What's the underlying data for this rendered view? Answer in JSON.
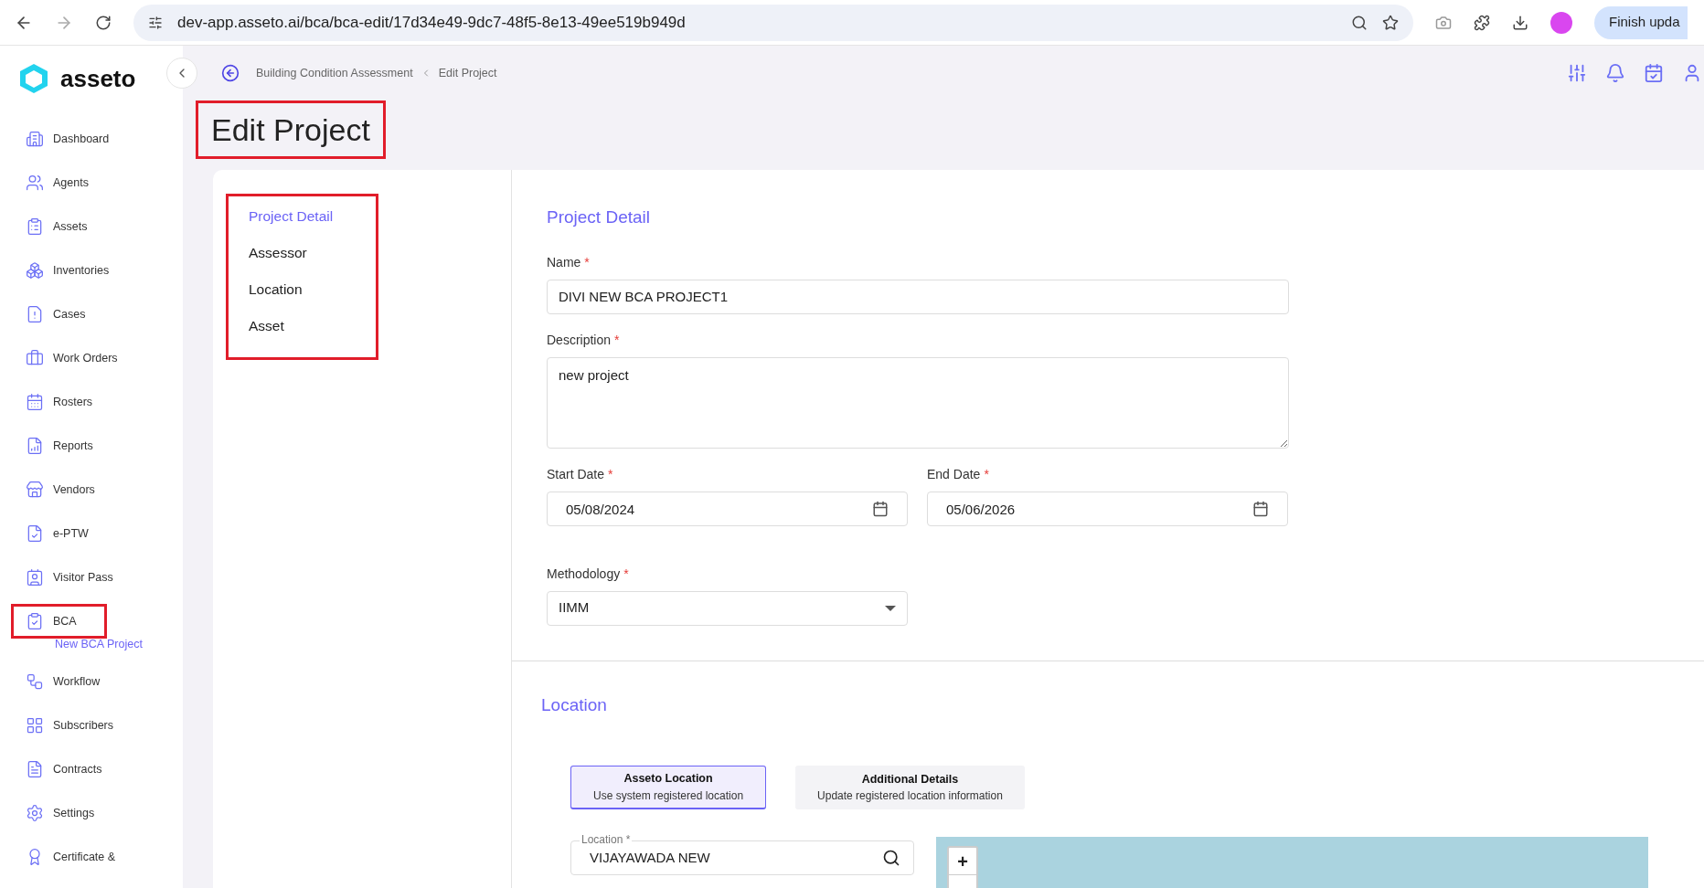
{
  "browser": {
    "url": "dev-app.asseto.ai/bca/bca-edit/17d34e49-9dc7-48f5-8e13-49ee519b949d",
    "update_button": "Finish upda"
  },
  "brand": {
    "name": "asseto"
  },
  "sidebar": {
    "items": [
      {
        "label": "Dashboard",
        "highlighted": false
      },
      {
        "label": "Agents",
        "highlighted": false
      },
      {
        "label": "Assets",
        "highlighted": false
      },
      {
        "label": "Inventories",
        "highlighted": false
      },
      {
        "label": "Cases",
        "highlighted": false
      },
      {
        "label": "Work Orders",
        "highlighted": false
      },
      {
        "label": "Rosters",
        "highlighted": false
      },
      {
        "label": "Reports",
        "highlighted": false
      },
      {
        "label": "Vendors",
        "highlighted": false
      },
      {
        "label": "e-PTW",
        "highlighted": false
      },
      {
        "label": "Visitor Pass",
        "highlighted": false
      },
      {
        "label": "BCA",
        "highlighted": true,
        "children": [
          {
            "label": "New BCA Project"
          }
        ]
      },
      {
        "label": "Workflow",
        "highlighted": false
      },
      {
        "label": "Subscribers",
        "highlighted": false
      },
      {
        "label": "Contracts",
        "highlighted": false
      },
      {
        "label": "Settings",
        "highlighted": false
      },
      {
        "label": "Certificate &",
        "highlighted": false
      }
    ]
  },
  "breadcrumb": [
    "Building Condition Assessment",
    "Edit Project"
  ],
  "page_title": {
    "text": "Edit Project",
    "highlighted": true
  },
  "section_nav": {
    "highlighted": true,
    "items": [
      {
        "label": "Project Detail",
        "selected": true
      },
      {
        "label": "Assessor",
        "selected": false
      },
      {
        "label": "Location",
        "selected": false
      },
      {
        "label": "Asset",
        "selected": false
      }
    ]
  },
  "project_detail": {
    "heading": "Project Detail",
    "name": {
      "label": "Name",
      "required_mark": "*",
      "value": "DIVI NEW BCA PROJECT1"
    },
    "description": {
      "label": "Description",
      "required_mark": "*",
      "value": "new project"
    },
    "start_date": {
      "label": "Start Date",
      "required_mark": "*",
      "value": "05/08/2024"
    },
    "end_date": {
      "label": "End Date",
      "required_mark": "*",
      "value": "05/06/2026"
    },
    "methodology": {
      "label": "Methodology",
      "required_mark": "*",
      "value": "IIMM"
    }
  },
  "location": {
    "heading": "Location",
    "tabs": [
      {
        "title": "Asseto Location",
        "subtitle": "Use system registered location",
        "selected": true
      },
      {
        "title": "Additional Details",
        "subtitle": "Update registered location information",
        "selected": false
      }
    ],
    "field": {
      "label": "Location *",
      "value": "VIJAYAWADA NEW"
    },
    "map": {
      "zoom_in": "+"
    }
  }
}
